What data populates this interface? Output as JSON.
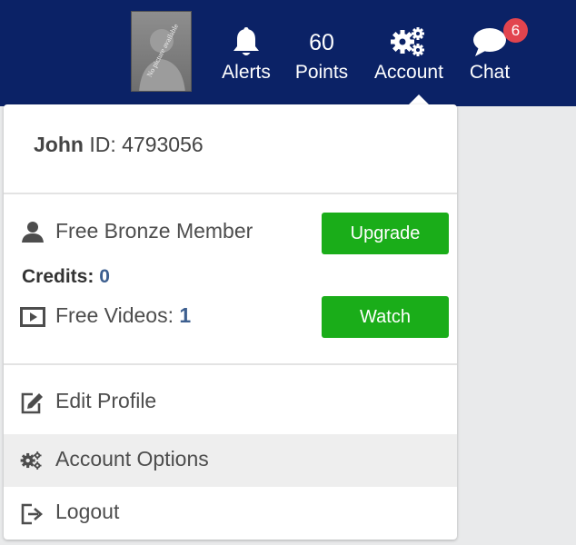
{
  "header": {
    "avatar_text": "No picture available",
    "nav": [
      {
        "name": "Alerts",
        "icon": "bell-icon"
      },
      {
        "name": "Points",
        "value": "60"
      },
      {
        "name": "Account",
        "icon": "gears-icon"
      },
      {
        "name": "Chat",
        "icon": "chat-bubble-icon",
        "badge": "6"
      }
    ]
  },
  "dropdown": {
    "user_name": "John",
    "user_id_label": "ID:",
    "user_id": "4793056",
    "membership_label": "Free Bronze Member",
    "upgrade_label": "Upgrade",
    "credits_label": "Credits:",
    "credits_value": "0",
    "free_videos_label": "Free Videos:",
    "free_videos_value": "1",
    "watch_label": "Watch",
    "menu": [
      {
        "label": "Edit Profile",
        "icon": "edit-icon"
      },
      {
        "label": "Account Options",
        "icon": "gears-icon",
        "highlighted": true
      },
      {
        "label": "Logout",
        "icon": "logout-icon"
      }
    ]
  },
  "colors": {
    "topbar": "#0b2266",
    "accent_green": "#1aad19",
    "badge_red": "#e2444e",
    "link_blue": "#3d5f8f"
  }
}
